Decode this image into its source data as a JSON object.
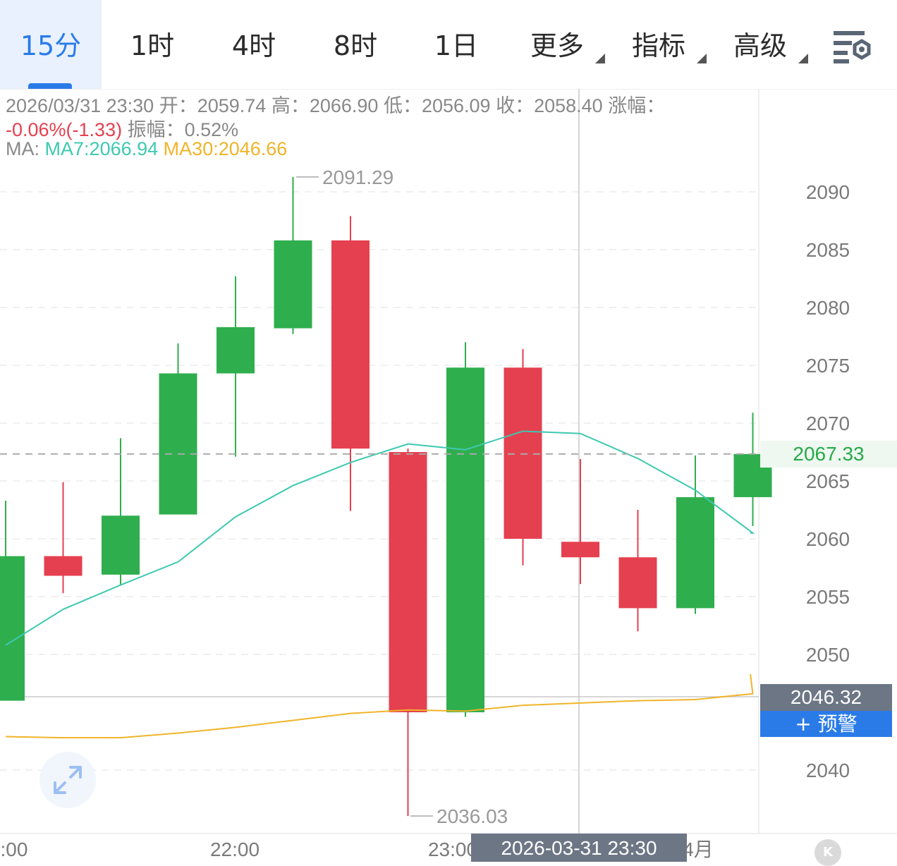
{
  "tabs": [
    {
      "label": "15分",
      "active": true,
      "has_menu": false
    },
    {
      "label": "1时",
      "active": false,
      "has_menu": false
    },
    {
      "label": "4时",
      "active": false,
      "has_menu": false
    },
    {
      "label": "8时",
      "active": false,
      "has_menu": false
    },
    {
      "label": "1日",
      "active": false,
      "has_menu": false
    },
    {
      "label": "更多",
      "active": false,
      "has_menu": true
    },
    {
      "label": "指标",
      "active": false,
      "has_menu": true
    },
    {
      "label": "高级",
      "active": false,
      "has_menu": true
    }
  ],
  "settings_icon": "chart-settings-icon",
  "info": {
    "datetime": "2026/03/31 23:30",
    "open_label": "开：",
    "open": "2059.74",
    "high_label": "高：",
    "high": "2066.90",
    "low_label": "低：",
    "low": "2056.09",
    "close_label": "收：",
    "close": "2058.40",
    "change_label": "涨幅：",
    "change": "-0.06%(-1.33)",
    "amplitude_label": "振幅：",
    "amplitude": "0.52%",
    "ma_label": "MA:",
    "ma7": "MA7:2066.94",
    "ma30": "MA30:2046.66"
  },
  "last_price": "2067.33",
  "crosshair_price": "2046.32",
  "alert_label": "+ 预警",
  "crosshair_time": "2026-03-31 23:30",
  "colors": {
    "up": "#2fae4e",
    "down": "#e5404f",
    "ma7": "#3ec9b0",
    "ma30": "#f0b429",
    "accent": "#2a7be8"
  },
  "chart_data": {
    "type": "candlestick",
    "y_ticks": [
      "2090",
      "2085",
      "2080",
      "2075",
      "2070",
      "2065",
      "2060",
      "2055",
      "2050",
      "2040"
    ],
    "x_ticks": [
      ":00",
      "22:00",
      "23:00",
      "4月"
    ],
    "high_marker": "2091.29",
    "low_marker": "2036.03",
    "candles": [
      {
        "open": 2046.0,
        "high": 2063.3,
        "low": 2046.0,
        "close": 2058.5
      },
      {
        "open": 2058.5,
        "high": 2064.9,
        "low": 2055.3,
        "close": 2056.8
      },
      {
        "open": 2056.9,
        "high": 2068.7,
        "low": 2056.0,
        "close": 2062.0
      },
      {
        "open": 2062.1,
        "high": 2076.9,
        "low": 2062.1,
        "close": 2074.3
      },
      {
        "open": 2074.3,
        "high": 2082.7,
        "low": 2067.1,
        "close": 2078.3
      },
      {
        "open": 2078.2,
        "high": 2091.29,
        "low": 2077.7,
        "close": 2085.8
      },
      {
        "open": 2085.8,
        "high": 2087.9,
        "low": 2062.4,
        "close": 2067.8
      },
      {
        "open": 2067.5,
        "high": 2067.8,
        "low": 2036.03,
        "close": 2045.0
      },
      {
        "open": 2045.0,
        "high": 2077.0,
        "low": 2044.6,
        "close": 2074.8
      },
      {
        "open": 2074.8,
        "high": 2076.4,
        "low": 2057.7,
        "close": 2060.0
      },
      {
        "open": 2059.74,
        "high": 2066.9,
        "low": 2056.09,
        "close": 2058.4
      },
      {
        "open": 2058.4,
        "high": 2062.5,
        "low": 2052.0,
        "close": 2054.0
      },
      {
        "open": 2054.0,
        "high": 2067.2,
        "low": 2053.5,
        "close": 2063.6
      },
      {
        "open": 2063.6,
        "high": 2070.9,
        "low": 2061.1,
        "close": 2067.33
      }
    ],
    "ma7": [
      2050.8,
      2053.9,
      2056.0,
      2058.0,
      2061.9,
      2064.6,
      2066.6,
      2068.2,
      2067.7,
      2069.3,
      2069.1,
      2066.94,
      2064.2,
      2060.5,
      2060.5
    ],
    "ma30": [
      2042.9,
      2042.8,
      2042.8,
      2043.2,
      2043.7,
      2044.3,
      2044.9,
      2045.2,
      2045.1,
      2045.6,
      2045.8,
      2046.0,
      2046.1,
      2046.6,
      2048.3
    ]
  }
}
